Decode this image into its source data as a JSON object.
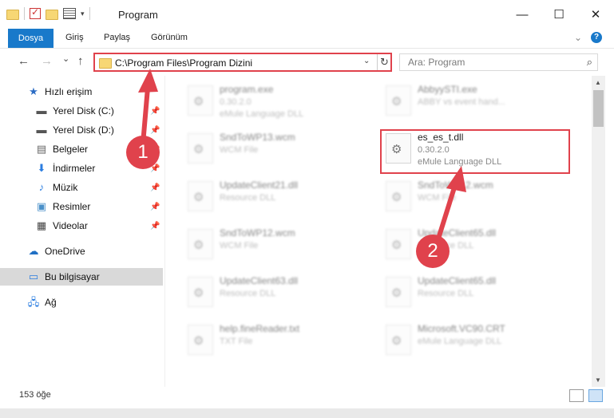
{
  "window": {
    "title": "Program",
    "controls": {
      "minimize": "—",
      "maximize": "☐",
      "close": "✕"
    }
  },
  "ribbon": {
    "tabs": [
      "Dosya",
      "Giriş",
      "Paylaş",
      "Görünüm"
    ],
    "expand_icon": "chevron-down-icon",
    "help": "?"
  },
  "navigation": {
    "back": "←",
    "forward": "→",
    "recent": "⌄",
    "up": "↑",
    "address": "C:\\Program Files\\Program Dizini",
    "search_placeholder": "Ara: Program"
  },
  "sidebar": {
    "items": [
      {
        "label": "Hızlı erişim",
        "icon": "star-icon",
        "glyph": "★",
        "color": "#2b6cc4",
        "pinned": false
      },
      {
        "label": "Yerel Disk (C:)",
        "icon": "drive-icon",
        "glyph": "▬",
        "color": "#555555",
        "pinned": true
      },
      {
        "label": "Yerel Disk (D:)",
        "icon": "drive-icon",
        "glyph": "▬",
        "color": "#555555",
        "pinned": true
      },
      {
        "label": "Belgeler",
        "icon": "document-icon",
        "glyph": "▤",
        "color": "#666666",
        "pinned": true
      },
      {
        "label": "İndirmeler",
        "icon": "download-icon",
        "glyph": "⬇",
        "color": "#2b7de0",
        "pinned": true
      },
      {
        "label": "Müzik",
        "icon": "music-icon",
        "glyph": "♪",
        "color": "#2b7de0",
        "pinned": true
      },
      {
        "label": "Resimler",
        "icon": "pictures-icon",
        "glyph": "▣",
        "color": "#4a90c9",
        "pinned": true
      },
      {
        "label": "Videolar",
        "icon": "video-icon",
        "glyph": "▦",
        "color": "#444444",
        "pinned": true
      },
      {
        "label": "OneDrive",
        "icon": "cloud-icon",
        "glyph": "☁",
        "color": "#1f6fc4",
        "pinned": false
      },
      {
        "label": "Bu bilgisayar",
        "icon": "computer-icon",
        "glyph": "▭",
        "color": "#2b7de0",
        "pinned": false,
        "selected": true
      },
      {
        "label": "Ağ",
        "icon": "network-icon",
        "glyph": "🖧",
        "color": "#2b7de0",
        "pinned": false
      }
    ]
  },
  "files": [
    {
      "name": "program.exe",
      "line2": "0.30.2.0",
      "line3": "eMule Language DLL",
      "blur": true
    },
    {
      "name": "AbbyySTI.exe",
      "line2": "ABBY vs event hand...",
      "blur": true
    },
    {
      "name": "SndToWP13.wcm",
      "line2": "WCM File",
      "blur": true
    },
    {
      "name": "es_es_t.dll",
      "line2": "0.30.2.0",
      "line3": "eMule Language DLL",
      "blur": false
    },
    {
      "name": "UpdateClient21.dll",
      "line2": "Resource DLL",
      "blur": true
    },
    {
      "name": "SndToWP12.wcm",
      "line2": "WCM File",
      "blur": true
    },
    {
      "name": "SndToWP12.wcm",
      "line2": "WCM File",
      "blur": true
    },
    {
      "name": "UpdateClient65.dll",
      "line2": "Resource DLL",
      "blur": true
    },
    {
      "name": "UpdateClient63.dll",
      "line2": "Resource DLL",
      "blur": true
    },
    {
      "name": "UpdateClient65.dll",
      "line2": "Resource DLL",
      "blur": true
    },
    {
      "name": "help.fineReader.txt",
      "line2": "TXT File",
      "blur": true
    },
    {
      "name": "Microsoft.VC90.CRT",
      "line2": "eMule Language DLL",
      "blur": true
    }
  ],
  "annotations": {
    "badge1": "1",
    "badge2": "2",
    "color": "#e0424c"
  },
  "status": {
    "item_count": "153 öğe"
  }
}
